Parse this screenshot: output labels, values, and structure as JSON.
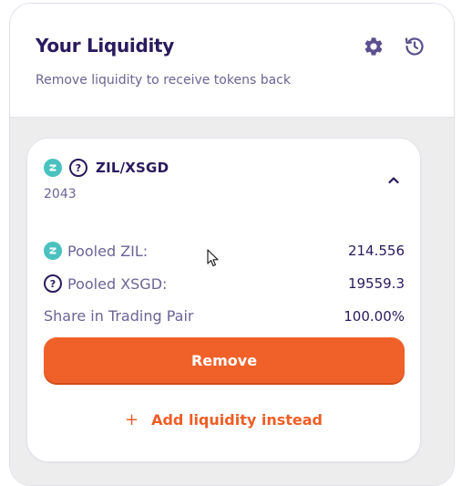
{
  "header": {
    "title": "Your Liquidity",
    "subtitle": "Remove liquidity to receive tokens back",
    "settings_icon": "gear-icon",
    "history_icon": "history-icon"
  },
  "position": {
    "pair_name": "ZIL/XSGD",
    "pair_subtitle": "2043",
    "collapse_icon": "chevron-up-icon",
    "rows": [
      {
        "label": "Pooled ZIL:",
        "value": "214.556",
        "icon": "zil-token-icon"
      },
      {
        "label": "Pooled XSGD:",
        "value": "19559.3",
        "icon": "unknown-token-icon"
      },
      {
        "label": "Share in Trading Pair",
        "value": "100.00%"
      }
    ],
    "remove_label": "Remove",
    "add_label": "Add liquidity instead",
    "add_prefix": "+"
  },
  "colors": {
    "accent": "#f0612a",
    "title": "#2a1a5e",
    "muted": "#6b6496",
    "zil": "#49c1bf"
  }
}
